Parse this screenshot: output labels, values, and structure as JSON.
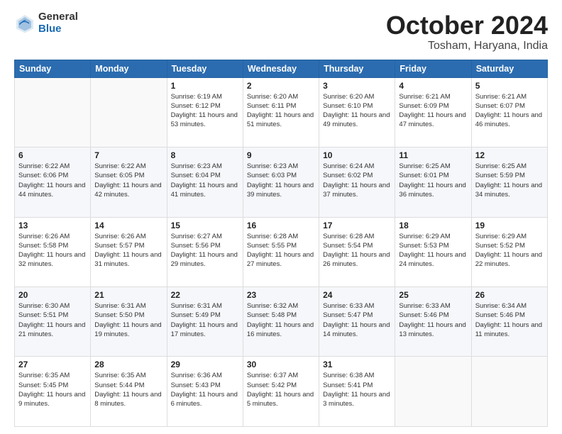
{
  "logo": {
    "general": "General",
    "blue": "Blue"
  },
  "title": {
    "month": "October 2024",
    "location": "Tosham, Haryana, India"
  },
  "header_days": [
    "Sunday",
    "Monday",
    "Tuesday",
    "Wednesday",
    "Thursday",
    "Friday",
    "Saturday"
  ],
  "weeks": [
    [
      {
        "day": "",
        "info": ""
      },
      {
        "day": "",
        "info": ""
      },
      {
        "day": "1",
        "info": "Sunrise: 6:19 AM\nSunset: 6:12 PM\nDaylight: 11 hours and 53 minutes."
      },
      {
        "day": "2",
        "info": "Sunrise: 6:20 AM\nSunset: 6:11 PM\nDaylight: 11 hours and 51 minutes."
      },
      {
        "day": "3",
        "info": "Sunrise: 6:20 AM\nSunset: 6:10 PM\nDaylight: 11 hours and 49 minutes."
      },
      {
        "day": "4",
        "info": "Sunrise: 6:21 AM\nSunset: 6:09 PM\nDaylight: 11 hours and 47 minutes."
      },
      {
        "day": "5",
        "info": "Sunrise: 6:21 AM\nSunset: 6:07 PM\nDaylight: 11 hours and 46 minutes."
      }
    ],
    [
      {
        "day": "6",
        "info": "Sunrise: 6:22 AM\nSunset: 6:06 PM\nDaylight: 11 hours and 44 minutes."
      },
      {
        "day": "7",
        "info": "Sunrise: 6:22 AM\nSunset: 6:05 PM\nDaylight: 11 hours and 42 minutes."
      },
      {
        "day": "8",
        "info": "Sunrise: 6:23 AM\nSunset: 6:04 PM\nDaylight: 11 hours and 41 minutes."
      },
      {
        "day": "9",
        "info": "Sunrise: 6:23 AM\nSunset: 6:03 PM\nDaylight: 11 hours and 39 minutes."
      },
      {
        "day": "10",
        "info": "Sunrise: 6:24 AM\nSunset: 6:02 PM\nDaylight: 11 hours and 37 minutes."
      },
      {
        "day": "11",
        "info": "Sunrise: 6:25 AM\nSunset: 6:01 PM\nDaylight: 11 hours and 36 minutes."
      },
      {
        "day": "12",
        "info": "Sunrise: 6:25 AM\nSunset: 5:59 PM\nDaylight: 11 hours and 34 minutes."
      }
    ],
    [
      {
        "day": "13",
        "info": "Sunrise: 6:26 AM\nSunset: 5:58 PM\nDaylight: 11 hours and 32 minutes."
      },
      {
        "day": "14",
        "info": "Sunrise: 6:26 AM\nSunset: 5:57 PM\nDaylight: 11 hours and 31 minutes."
      },
      {
        "day": "15",
        "info": "Sunrise: 6:27 AM\nSunset: 5:56 PM\nDaylight: 11 hours and 29 minutes."
      },
      {
        "day": "16",
        "info": "Sunrise: 6:28 AM\nSunset: 5:55 PM\nDaylight: 11 hours and 27 minutes."
      },
      {
        "day": "17",
        "info": "Sunrise: 6:28 AM\nSunset: 5:54 PM\nDaylight: 11 hours and 26 minutes."
      },
      {
        "day": "18",
        "info": "Sunrise: 6:29 AM\nSunset: 5:53 PM\nDaylight: 11 hours and 24 minutes."
      },
      {
        "day": "19",
        "info": "Sunrise: 6:29 AM\nSunset: 5:52 PM\nDaylight: 11 hours and 22 minutes."
      }
    ],
    [
      {
        "day": "20",
        "info": "Sunrise: 6:30 AM\nSunset: 5:51 PM\nDaylight: 11 hours and 21 minutes."
      },
      {
        "day": "21",
        "info": "Sunrise: 6:31 AM\nSunset: 5:50 PM\nDaylight: 11 hours and 19 minutes."
      },
      {
        "day": "22",
        "info": "Sunrise: 6:31 AM\nSunset: 5:49 PM\nDaylight: 11 hours and 17 minutes."
      },
      {
        "day": "23",
        "info": "Sunrise: 6:32 AM\nSunset: 5:48 PM\nDaylight: 11 hours and 16 minutes."
      },
      {
        "day": "24",
        "info": "Sunrise: 6:33 AM\nSunset: 5:47 PM\nDaylight: 11 hours and 14 minutes."
      },
      {
        "day": "25",
        "info": "Sunrise: 6:33 AM\nSunset: 5:46 PM\nDaylight: 11 hours and 13 minutes."
      },
      {
        "day": "26",
        "info": "Sunrise: 6:34 AM\nSunset: 5:46 PM\nDaylight: 11 hours and 11 minutes."
      }
    ],
    [
      {
        "day": "27",
        "info": "Sunrise: 6:35 AM\nSunset: 5:45 PM\nDaylight: 11 hours and 9 minutes."
      },
      {
        "day": "28",
        "info": "Sunrise: 6:35 AM\nSunset: 5:44 PM\nDaylight: 11 hours and 8 minutes."
      },
      {
        "day": "29",
        "info": "Sunrise: 6:36 AM\nSunset: 5:43 PM\nDaylight: 11 hours and 6 minutes."
      },
      {
        "day": "30",
        "info": "Sunrise: 6:37 AM\nSunset: 5:42 PM\nDaylight: 11 hours and 5 minutes."
      },
      {
        "day": "31",
        "info": "Sunrise: 6:38 AM\nSunset: 5:41 PM\nDaylight: 11 hours and 3 minutes."
      },
      {
        "day": "",
        "info": ""
      },
      {
        "day": "",
        "info": ""
      }
    ]
  ]
}
